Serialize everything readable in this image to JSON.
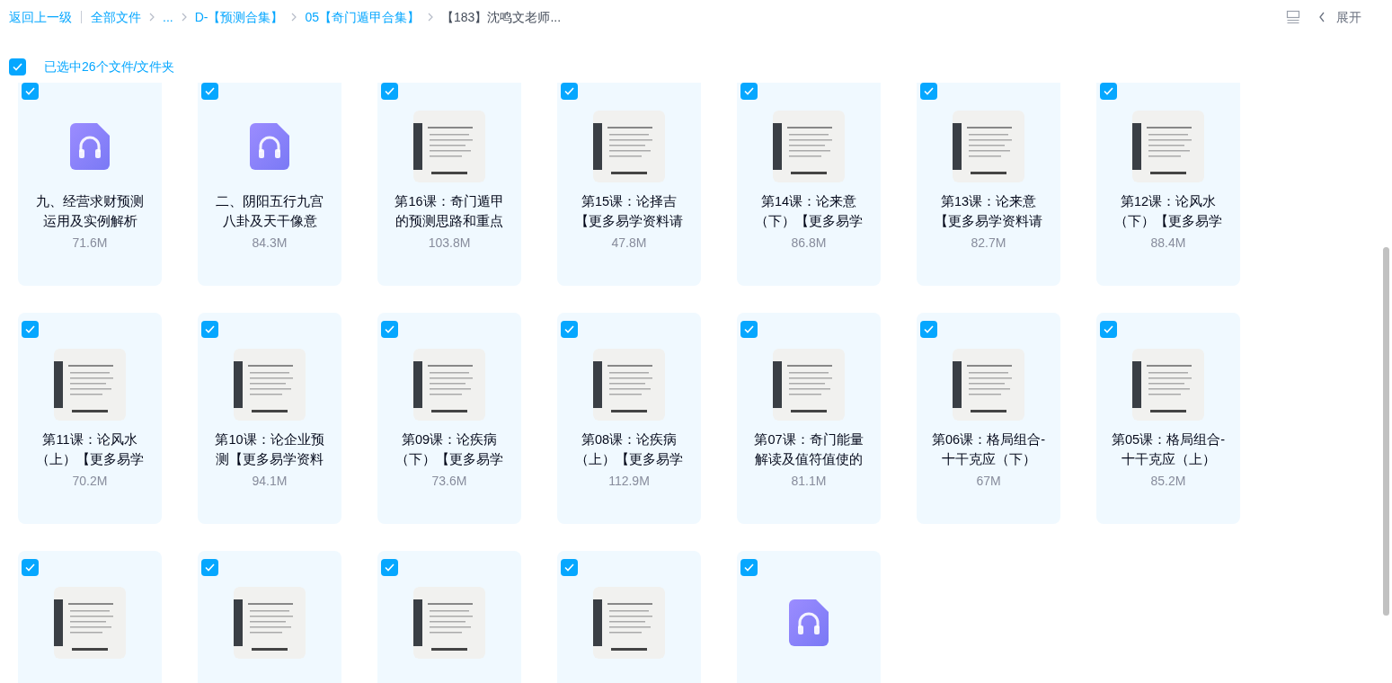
{
  "toolbar": {
    "back_link": "返回上一级",
    "breadcrumbs": [
      {
        "label": "全部文件",
        "current": false
      },
      {
        "label": "...",
        "current": false
      },
      {
        "label": "D-【预测合集】",
        "current": false
      },
      {
        "label": "05【奇门遁甲合集】",
        "current": false
      },
      {
        "label": "【183】沈鸣文老师...",
        "current": true
      }
    ],
    "expand_button": "展开"
  },
  "selection": {
    "checked": true,
    "label": "已选中26个文件/文件夹"
  },
  "files": [
    {
      "kind": "audio",
      "checked": true,
      "name": "九、经营求财预测运用及实例解析",
      "size": "71.6M"
    },
    {
      "kind": "audio",
      "checked": true,
      "name": "二、阴阳五行九宫八卦及天干像意",
      "size": "84.3M"
    },
    {
      "kind": "video",
      "checked": true,
      "name": "第16课：奇门遁甲的预测思路和重点",
      "size": "103.8M"
    },
    {
      "kind": "video",
      "checked": true,
      "name": "第15课：论择吉【更多易学资料请",
      "size": "47.8M"
    },
    {
      "kind": "video",
      "checked": true,
      "name": "第14课：论来意（下）【更多易学",
      "size": "86.8M"
    },
    {
      "kind": "video",
      "checked": true,
      "name": "第13课：论来意【更多易学资料请",
      "size": "82.7M"
    },
    {
      "kind": "video",
      "checked": true,
      "name": "第12课：论风水（下）【更多易学",
      "size": "88.4M"
    },
    {
      "kind": "video",
      "checked": true,
      "name": "第11课：论风水（上）【更多易学",
      "size": "70.2M"
    },
    {
      "kind": "video",
      "checked": true,
      "name": "第10课：论企业预测【更多易学资料",
      "size": "94.1M"
    },
    {
      "kind": "video",
      "checked": true,
      "name": "第09课：论疾病（下）【更多易学",
      "size": "73.6M"
    },
    {
      "kind": "video",
      "checked": true,
      "name": "第08课：论疾病（上）【更多易学",
      "size": "112.9M"
    },
    {
      "kind": "video",
      "checked": true,
      "name": "第07课：奇门能量解读及值符值使的",
      "size": "81.1M"
    },
    {
      "kind": "video",
      "checked": true,
      "name": "第06课：格局组合-十干克应（下）",
      "size": "67M"
    },
    {
      "kind": "video",
      "checked": true,
      "name": "第05课：格局组合-十干克应（上）",
      "size": "85.2M"
    },
    {
      "kind": "video",
      "checked": true
    },
    {
      "kind": "video",
      "checked": true
    },
    {
      "kind": "video",
      "checked": true
    },
    {
      "kind": "video",
      "checked": true
    },
    {
      "kind": "audio",
      "checked": true
    }
  ]
}
